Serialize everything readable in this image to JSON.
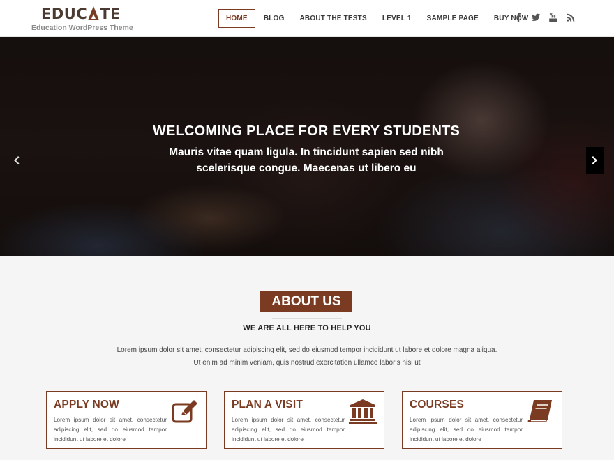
{
  "header": {
    "logo_text_left": "EDUC",
    "logo_text_right": "TE",
    "logo_tagline": "Education WordPress Theme",
    "nav": [
      "HOME",
      "BLOG",
      "ABOUT THE TESTS",
      "LEVEL 1",
      "SAMPLE PAGE",
      "BUY NOW"
    ],
    "active_nav": "HOME",
    "social_icons": [
      "facebook-icon",
      "twitter-icon",
      "youtube-icon",
      "rss-icon"
    ]
  },
  "hero": {
    "title": "WELCOMING PLACE FOR EVERY STUDENTS",
    "subtitle": "Mauris vitae quam ligula. In tincidunt sapien sed nibh scelerisque congue. Maecenas ut libero eu"
  },
  "about": {
    "title": "ABOUT US",
    "subtitle": "WE ARE ALL HERE TO HELP YOU",
    "line1": "Lorem ipsum dolor sit amet, consectetur adipiscing elit, sed do eiusmod tempor incididunt ut labore et dolore magna aliqua.",
    "line2": "Ut enim ad minim veniam, quis nostrud exercitation ullamco laboris nisi ut"
  },
  "cards": [
    {
      "title": "APPLY NOW",
      "text": "Lorem ipsum dolor sit amet, consectetur adipiscing elit, sed do eiusmod tempor incididunt ut labore et dolore",
      "icon": "edit-icon"
    },
    {
      "title": "PLAN A VISIT",
      "text": "Lorem ipsum dolor sit amet, consectetur adipiscing elit, sed do eiusmod tempor incididunt ut labore et dolore",
      "icon": "institution-icon"
    },
    {
      "title": "COURSES",
      "text": "Lorem ipsum dolor sit amet, consectetur adipiscing elit, sed do eiusmod tempor incididunt ut labore et dolore",
      "icon": "book-icon"
    }
  ],
  "colors": {
    "accent": "#7a3b22",
    "background": "#f5f5f5",
    "header_bg": "#ffffff"
  }
}
